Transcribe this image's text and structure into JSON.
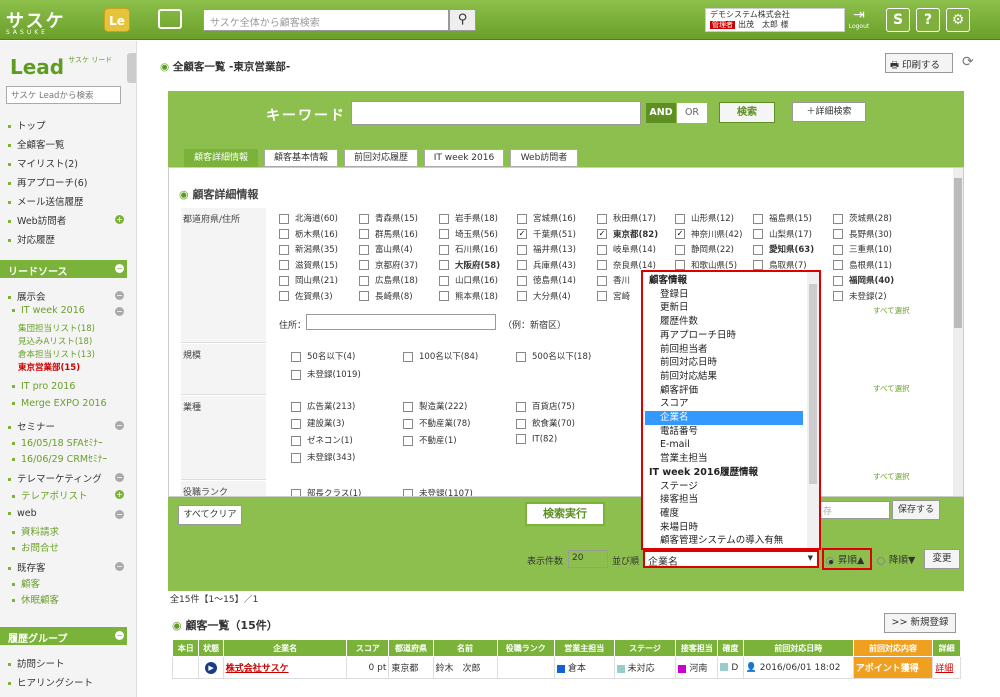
{
  "header": {
    "logo": "サスケ",
    "logo_sub": "SASUKE",
    "badge": "Le",
    "search_placeholder": "サスケ全体から顧客検索",
    "company": "デモシステム株式会社",
    "role_tag": "管理者",
    "user": "出茂　太郎 様",
    "logout": "Logout",
    "btn1": "S",
    "btn2": "?",
    "btn3": "⚙"
  },
  "sidebar": {
    "logo": "Lead",
    "logo_sub": "サスケ リード",
    "search_placeholder": "サスケ Leadから検索",
    "nav": [
      "トップ",
      "全顧客一覧",
      "マイリスト(2)",
      "再アプローチ(6)",
      "メール送信履歴",
      "Web訪問者",
      "対応履歴"
    ],
    "lead_source": "リードソース",
    "exhibit": "展示会",
    "itweek": "IT week 2016",
    "itweek_subs": [
      "集団担当リスト(18)",
      "見込みAリスト(18)",
      "倉本担当リスト(13)",
      "東京営業部(15)"
    ],
    "itpro": "IT pro 2016",
    "merge": "Merge EXPO 2016",
    "seminar": "セミナー",
    "seminar_subs": [
      "16/05/18 SFAｾﾐﾅｰ",
      "16/06/29 CRMｾﾐﾅｰ"
    ],
    "tele": "テレマーケティング",
    "tele_sub": "テレアポリスト",
    "web": "web",
    "web_subs": [
      "資料請求",
      "お問合せ"
    ],
    "existing": "既存客",
    "existing_subs": [
      "顧客",
      "休眠顧客"
    ],
    "group": "履歴グループ",
    "group_items": [
      "訪問シート",
      "ヒアリングシート"
    ]
  },
  "page": {
    "title": "全顧客一覧 -東京営業部-",
    "print": "印刷する",
    "keyword_label": "キーワード",
    "and": "AND",
    "or": "OR",
    "search": "検索",
    "advanced": "＋詳細検索",
    "tabs": [
      "顧客詳細情報",
      "顧客基本情報",
      "前回対応履歴",
      "IT week 2016",
      "Web訪問者"
    ],
    "panel_title": "顧客詳細情報",
    "pref_label": "都道府県/住所",
    "address_label": "住所：",
    "address_hint": "（例：新宿区）",
    "all_select": "すべて選択",
    "scale_label": "規模",
    "industry_label": "業種",
    "rank_label": "役職ランク",
    "clear": "すべてクリア",
    "run": "検索実行",
    "save_placeholder": "存",
    "save": "保存する",
    "display_count_label": "表示件数",
    "display_count": "20",
    "sort_label": "並び順",
    "sort_value": "企業名",
    "asc": "昇順▲",
    "desc": "降順▼",
    "change": "変更",
    "count": "全15件【1～15】／1",
    "list_title": "顧客一覧（15件）",
    "new": ">> 新規登録"
  },
  "prefs": [
    [
      "北海道(60)",
      "青森県(15)",
      "岩手県(18)",
      "宮城県(16)",
      "秋田県(17)",
      "山形県(12)",
      "福島県(15)",
      "茨城県(28)"
    ],
    [
      "栃木県(16)",
      "群馬県(16)",
      "埼玉県(56)",
      "千葉県(51)",
      "東京都(82)",
      "神奈川県(42)",
      "山梨県(17)",
      "長野県(30)"
    ],
    [
      "新潟県(35)",
      "富山県(4)",
      "石川県(16)",
      "福井県(13)",
      "岐阜県(14)",
      "静岡県(22)",
      "愛知県(63)",
      "三重県(10)"
    ],
    [
      "滋賀県(15)",
      "京都府(37)",
      "大阪府(58)",
      "兵庫県(43)",
      "奈良県(14)",
      "和歌山県(5)",
      "鳥取県(7)",
      "島根県(11)"
    ],
    [
      "岡山県(21)",
      "広島県(18)",
      "山口県(16)",
      "徳島県(14)",
      "香川",
      "",
      "",
      "福岡県(40)"
    ],
    [
      "佐賀県(3)",
      "長崎県(8)",
      "熊本県(18)",
      "大分県(4)",
      "宮崎",
      "",
      "",
      "未登録(2)"
    ]
  ],
  "scale": [
    "50名以下(4)",
    "100名以下(84)",
    "500名以下(18)",
    "未登録(1019)"
  ],
  "industry": [
    "広告業(213)",
    "製造業(222)",
    "百貨店(75)",
    "建設業(3)",
    "不動産業(78)",
    "飲食業(70)",
    "ゼネコン(1)",
    "不動産(1)",
    "IT(82)",
    "未登録(343)"
  ],
  "rank": [
    "部長クラス(1)",
    "未登録(1107)"
  ],
  "dropdown": [
    {
      "label": "顧客情報",
      "grp": true
    },
    {
      "label": "登録日"
    },
    {
      "label": "更新日"
    },
    {
      "label": "履歴件数"
    },
    {
      "label": "再アプローチ日時"
    },
    {
      "label": "前回担当者"
    },
    {
      "label": "前回対応日時"
    },
    {
      "label": "前回対応結果"
    },
    {
      "label": "顧客評価"
    },
    {
      "label": "スコア"
    },
    {
      "label": "企業名",
      "sel": true
    },
    {
      "label": "電話番号"
    },
    {
      "label": "E-mail"
    },
    {
      "label": "営業主担当"
    },
    {
      "label": "IT week 2016履歴情報",
      "grp": true
    },
    {
      "label": "ステージ"
    },
    {
      "label": "接客担当"
    },
    {
      "label": "確度"
    },
    {
      "label": "来場日時"
    },
    {
      "label": "顧客管理システムの導入有無"
    }
  ],
  "table": {
    "headers": [
      "本日",
      "状態",
      "企業名",
      "スコア",
      "都道府県",
      "名前",
      "役職ランク",
      "営業主担当",
      "ステージ",
      "接客担当",
      "確度",
      "前回対応日時",
      "前回対応内容",
      "詳細"
    ],
    "row": {
      "company": "株式会社サスケ",
      "score": "0 pt",
      "pref": "東京都",
      "name": "鈴木　次郎",
      "sales": "倉本",
      "stage": "未対応",
      "staff": "河南",
      "conf": "D",
      "date": "2016/06/01 18:02",
      "content": "アポイント獲得",
      "detail": "詳細"
    }
  },
  "colors": {
    "brand": "#7ab23a",
    "accent_red": "#d00",
    "select_blue": "#3399ff"
  }
}
